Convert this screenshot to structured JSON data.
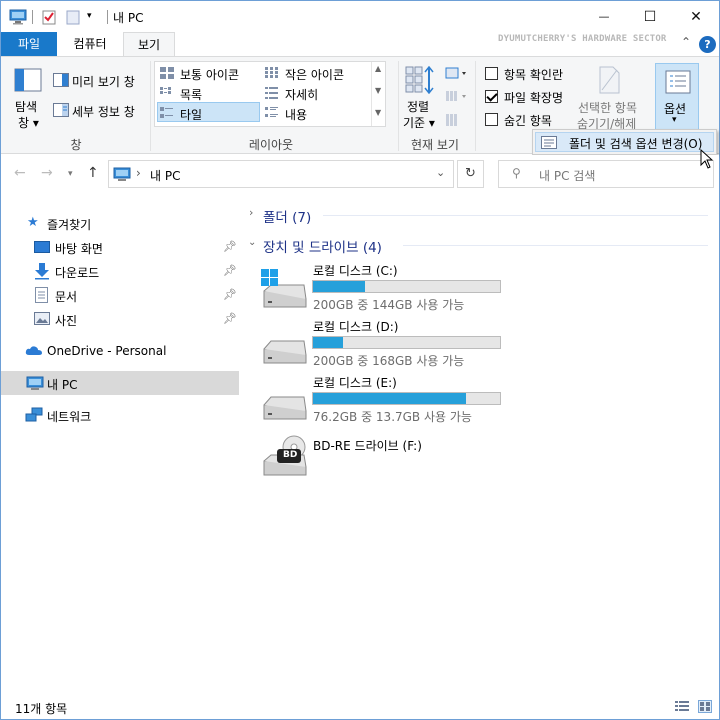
{
  "window": {
    "title": "내 PC",
    "accent": "#1979ca"
  },
  "window_buttons": {
    "minimize": "—",
    "maximize": "☐",
    "close": "✕"
  },
  "ribbon_tabs": [
    {
      "label": "파일"
    },
    {
      "label": "컴퓨터"
    },
    {
      "label": "보기"
    }
  ],
  "watermark": "DYUMUTCHERRY'S HARDWARE SECTOR",
  "help_label": "?",
  "panes_group": {
    "nav_pane_line1": "탐색",
    "nav_pane_line2": "창 ▾",
    "preview_pane": "미리 보기 창",
    "details_pane": "세부 정보 창",
    "label": "창"
  },
  "layout_group": {
    "items": [
      "보통 아이콘",
      "작은 아이콘",
      "목록",
      "자세히",
      "타일",
      "내용"
    ],
    "label": "레이아웃"
  },
  "current_view_group": {
    "sort_line1": "정렬",
    "sort_line2": "기준 ▾",
    "label": "현재 보기"
  },
  "show_hide_group": {
    "item_checkboxes": {
      "label": "항목 확인란",
      "checked": false
    },
    "file_extensions": {
      "label": "파일 확장명",
      "checked": true
    },
    "hidden_items": {
      "label": "숨긴 항목",
      "checked": false
    },
    "hide_selected_line1": "선택한 항목",
    "hide_selected_line2": "숨기기/해제"
  },
  "options_button": {
    "label": "옵션",
    "arrow": "▾"
  },
  "options_menu": {
    "item": "폴더 및 검색 옵션 변경(O)"
  },
  "address": {
    "path": "내 PC",
    "separator": "›"
  },
  "search": {
    "placeholder": "내 PC 검색"
  },
  "nav_pane": {
    "quick_access": "즐겨찾기",
    "quick_items": [
      "바탕 화면",
      "다운로드",
      "문서",
      "사진"
    ],
    "onedrive": "OneDrive - Personal",
    "this_pc": "내 PC",
    "network": "네트워크"
  },
  "groups": {
    "folders": "폴더 (7)",
    "devices": "장치 및 드라이브 (4)"
  },
  "drives": [
    {
      "name": "로컬 디스크 (C:)",
      "free": "200GB 중 144GB 사용 가능",
      "used_fraction": 0.28
    },
    {
      "name": "로컬 디스크 (D:)",
      "free": "200GB 중 168GB 사용 가능",
      "used_fraction": 0.16
    },
    {
      "name": "로컬 디스크 (E:)",
      "free": "76.2GB 중 13.7GB 사용 가능",
      "used_fraction": 0.82
    },
    {
      "name": "BD-RE 드라이브 (F:)",
      "badge": "BD"
    }
  ],
  "status": {
    "item_count": "11개 항목"
  }
}
